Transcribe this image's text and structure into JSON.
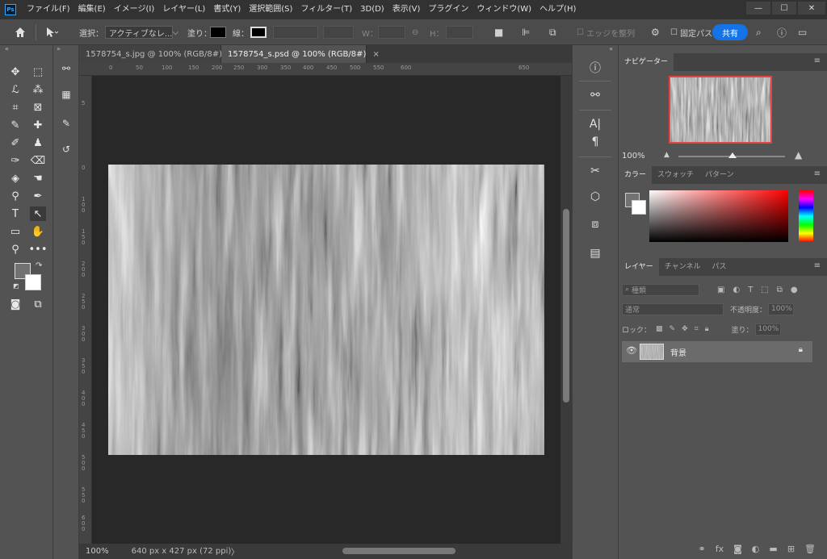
{
  "app": {
    "logo": "Ps"
  },
  "menu": [
    "ファイル(F)",
    "編集(E)",
    "イメージ(I)",
    "レイヤー(L)",
    "書式(Y)",
    "選択範囲(S)",
    "フィルター(T)",
    "3D(D)",
    "表示(V)",
    "プラグイン",
    "ウィンドウ(W)",
    "ヘルプ(H)"
  ],
  "window": {
    "minimize": "—",
    "maximize": "☐",
    "close": "✕"
  },
  "options": {
    "select_label": "選択：",
    "select_value": "アクティブなレ...",
    "fill_label": "塗り：",
    "stroke_label": "線：",
    "w_label": "W：",
    "h_label": "H：",
    "align_edges": "エッジを整列",
    "fixed_path": "固定パス",
    "share": "共有"
  },
  "tabs": [
    {
      "label": "1578754_s.jpg @ 100% (RGB/8#)",
      "close": "×",
      "active": false
    },
    {
      "label": "1578754_s.psd @ 100% (RGB/8#)",
      "close": "×",
      "active": true
    }
  ],
  "ruler_top": [
    "0",
    "50",
    "100",
    "150",
    "200",
    "250",
    "300",
    "350",
    "400",
    "450",
    "500",
    "550",
    "600",
    "650"
  ],
  "ruler_left": [
    "0",
    "5",
    "1 0 0",
    "1 5 0",
    "2 0 0",
    "2 5 0",
    "3 0 0",
    "3 5 0",
    "4 0 0",
    "4 5 0",
    "5 0 0",
    "5 5 0",
    "6 0 0"
  ],
  "status": {
    "zoom": "100%",
    "info": "640 px x 427 px (72 ppi)",
    "arrow": "〉"
  },
  "navigator": {
    "tab": "ナビゲーター",
    "zoom": "100%"
  },
  "color_panel": {
    "tabs": [
      "カラー",
      "スウォッチ",
      "パターン"
    ]
  },
  "layers_panel": {
    "tabs": [
      "レイヤー",
      "チャンネル",
      "パス"
    ],
    "search_placeholder": "種類",
    "blend_mode": "通常",
    "opacity_label": "不透明度：",
    "opacity_value": "100%",
    "lock_label": "ロック：",
    "fill_label": "塗り：",
    "fill_value": "100%",
    "layers": [
      {
        "name": "背景",
        "visible": true,
        "locked": true
      }
    ]
  }
}
